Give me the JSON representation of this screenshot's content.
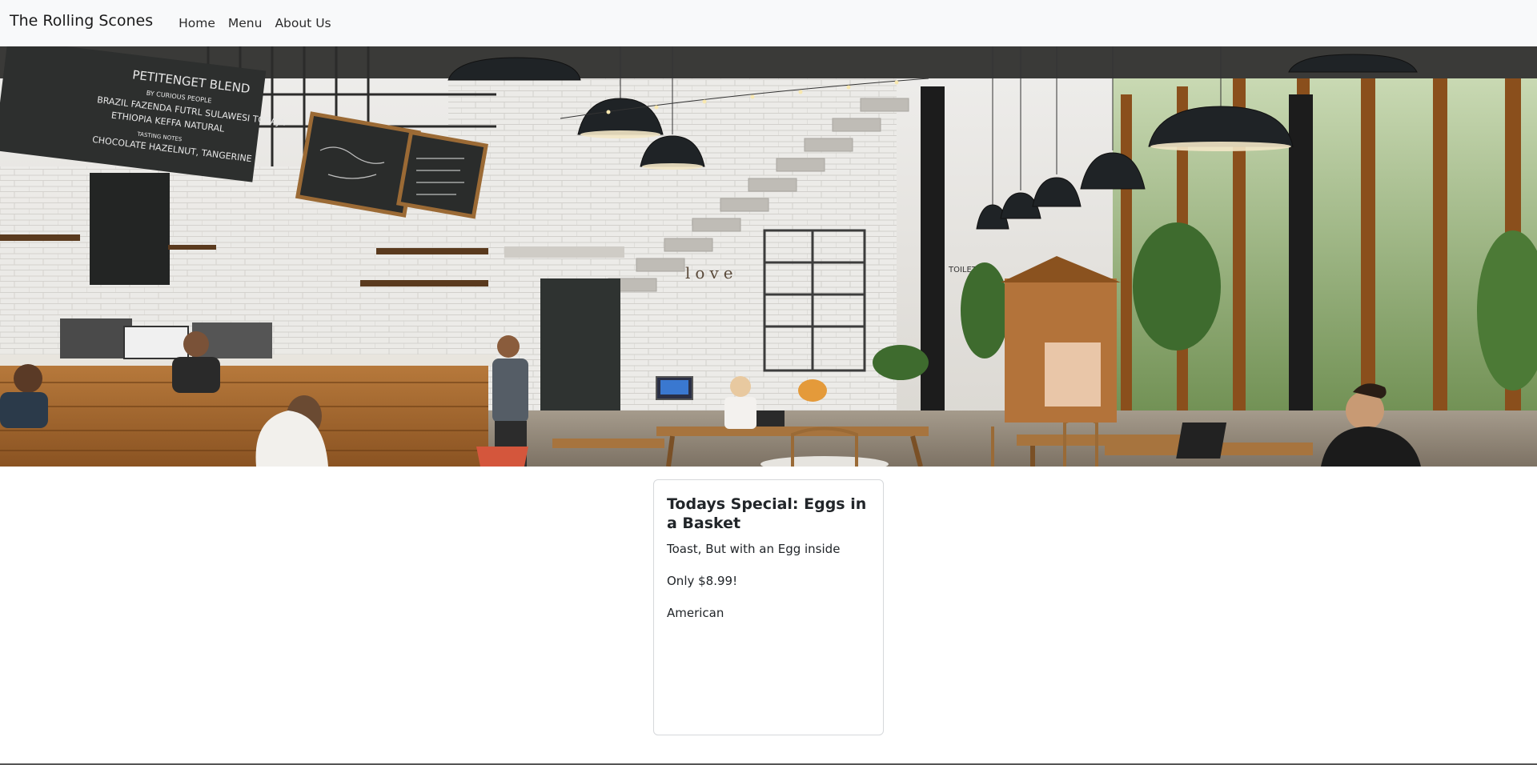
{
  "navbar": {
    "brand": "The Rolling Scones",
    "links": [
      {
        "label": "Home"
      },
      {
        "label": "Menu"
      },
      {
        "label": "About Us"
      }
    ]
  },
  "hero": {
    "signs": {
      "chalkboard_main": [
        "PETITENGET BLEND",
        "BY CURIOUS PEOPLE",
        "BRAZIL FAZENDA FUTRL SULAWESI TORAJA",
        "ETHIOPIA KEFFA NATURAL",
        "TASTING NOTES",
        "CHOCOLATE HAZELNUT, TANGERINE"
      ],
      "wall_letters": "love",
      "toilet_sign": "TOILET"
    }
  },
  "special": {
    "title": "Todays Special: Eggs in a Basket",
    "description": "Toast, But with an Egg inside",
    "price": "Only $8.99!",
    "cuisine": "American"
  },
  "colors": {
    "navbar_bg": "#f8f9fa",
    "card_border": "#d6d8db"
  }
}
